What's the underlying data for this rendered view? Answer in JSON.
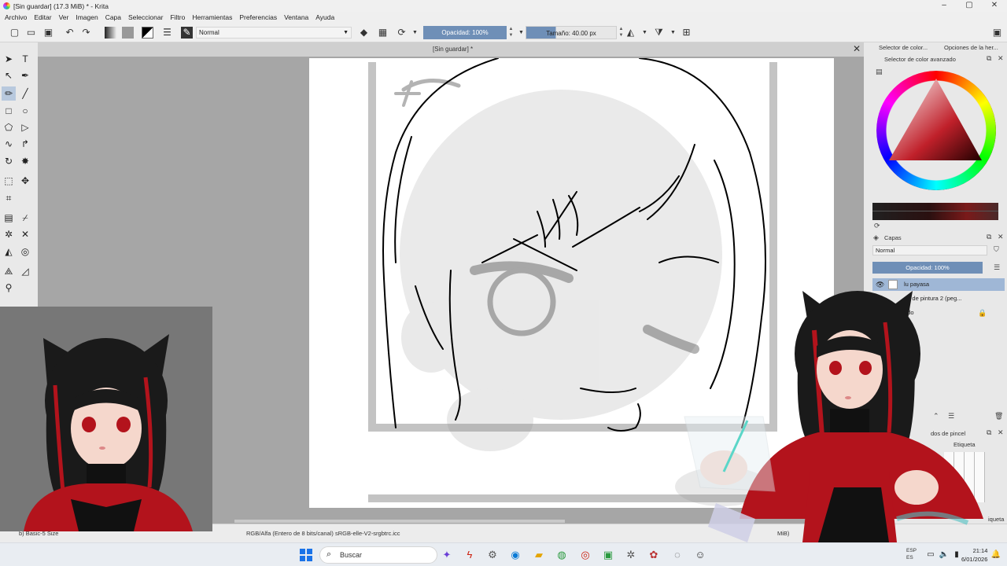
{
  "window": {
    "title": "[Sin guardar]  (17.3 MiB)  * - Krita",
    "minimize": "–",
    "maximize": "▢",
    "close": "✕"
  },
  "menu": [
    "Archivo",
    "Editar",
    "Ver",
    "Imagen",
    "Capa",
    "Seleccionar",
    "Filtro",
    "Herramientas",
    "Preferencias",
    "Ventana",
    "Ayuda"
  ],
  "toolbar": {
    "blend_mode": "Normal",
    "opacity": "Opacidad: 100%",
    "size": "Tamaño: 40.00 px"
  },
  "document": {
    "tab_title": "[Sin guardar]  *",
    "close": "✕"
  },
  "dockers": {
    "tab_color_selector": "Selector de color...",
    "tab_tool_options": "Opciones de la her...",
    "advanced_color_selector": "Selector de color avanzado",
    "layers_title": "Capas",
    "layers_blend": "Normal",
    "layers_opacity": "Opacidad:  100%",
    "layers": [
      {
        "name": "lu payasa",
        "selected": true
      },
      {
        "name": "pa de pintura 2 (peg...",
        "selected": false
      },
      {
        "name": "ndo",
        "selected": false
      }
    ],
    "brush_presets_title": "dos de pincel",
    "brush_tag": "Etiqueta",
    "brush_tag_bottom": "iqueta"
  },
  "status": {
    "brush": "b) Basic-5 Size",
    "colorspace": "RGB/Alfa (Entero de 8 bits/canal)  sRGB-elle-V2-srgbtrc.icc",
    "memory": "MiB)"
  },
  "taskbar": {
    "search_text": "Buscar",
    "lang_line1": "ESP",
    "lang_line2": "ES",
    "time": "21:14",
    "date": "6/01/2026"
  },
  "colors": {
    "accent": "#6f8fb7",
    "canvas_bg": "#a6a6a6",
    "selected_layer": "#9fb7d6",
    "avatar_hair": "#1a1a1a",
    "avatar_red": "#b3131c"
  }
}
